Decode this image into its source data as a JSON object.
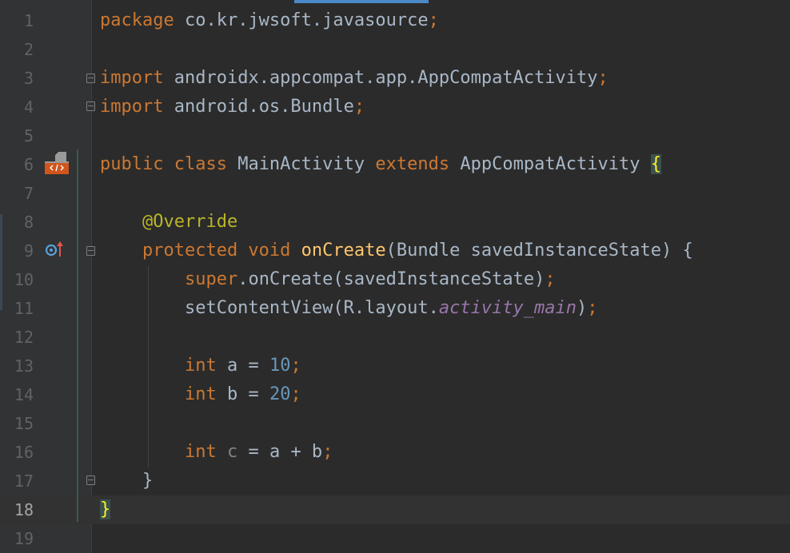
{
  "editor": {
    "lines": [
      {
        "n": "1",
        "code": [
          {
            "c": "kw",
            "t": "package"
          },
          {
            "t": " co.kr.jwsoft.javasource"
          },
          {
            "c": "kw",
            "t": ";"
          }
        ]
      },
      {
        "n": "2",
        "code": []
      },
      {
        "n": "3",
        "code": [
          {
            "c": "kw",
            "t": "import"
          },
          {
            "t": " androidx.appcompat.app.AppCompatActivity"
          },
          {
            "c": "kw",
            "t": ";"
          }
        ]
      },
      {
        "n": "4",
        "code": [
          {
            "c": "kw",
            "t": "import"
          },
          {
            "t": " android.os.Bundle"
          },
          {
            "c": "kw",
            "t": ";"
          }
        ]
      },
      {
        "n": "5",
        "code": []
      },
      {
        "n": "6",
        "code": [
          {
            "c": "kw",
            "t": "public class"
          },
          {
            "t": " MainActivity "
          },
          {
            "c": "kw",
            "t": "extends"
          },
          {
            "t": " AppCompatActivity "
          },
          {
            "c": "brace-hl",
            "t": "{"
          }
        ]
      },
      {
        "n": "7",
        "code": []
      },
      {
        "n": "8",
        "code": [
          {
            "t": "    "
          },
          {
            "c": "ann",
            "t": "@Override"
          }
        ]
      },
      {
        "n": "9",
        "code": [
          {
            "t": "    "
          },
          {
            "c": "kw",
            "t": "protected void"
          },
          {
            "t": " "
          },
          {
            "c": "fn",
            "t": "onCreate"
          },
          {
            "t": "(Bundle savedInstanceState) {"
          }
        ]
      },
      {
        "n": "10",
        "code": [
          {
            "t": "        "
          },
          {
            "c": "kw",
            "t": "super"
          },
          {
            "t": ".onCreate(savedInstanceState)"
          },
          {
            "c": "kw",
            "t": ";"
          }
        ]
      },
      {
        "n": "11",
        "code": [
          {
            "t": "        setContentView(R.layout."
          },
          {
            "c": "field",
            "t": "activity_main"
          },
          {
            "t": ")"
          },
          {
            "c": "kw",
            "t": ";"
          }
        ]
      },
      {
        "n": "12",
        "code": []
      },
      {
        "n": "13",
        "code": [
          {
            "t": "        "
          },
          {
            "c": "kw",
            "t": "int"
          },
          {
            "t": " a = "
          },
          {
            "c": "num",
            "t": "10"
          },
          {
            "c": "kw",
            "t": ";"
          }
        ]
      },
      {
        "n": "14",
        "code": [
          {
            "t": "        "
          },
          {
            "c": "kw",
            "t": "int"
          },
          {
            "t": " b = "
          },
          {
            "c": "num",
            "t": "20"
          },
          {
            "c": "kw",
            "t": ";"
          }
        ]
      },
      {
        "n": "15",
        "code": []
      },
      {
        "n": "16",
        "code": [
          {
            "t": "        "
          },
          {
            "c": "kw",
            "t": "int"
          },
          {
            "t": " "
          },
          {
            "c": "unused",
            "t": "c"
          },
          {
            "t": " = a + b"
          },
          {
            "c": "kw",
            "t": ";"
          }
        ]
      },
      {
        "n": "17",
        "code": [
          {
            "t": "    }"
          }
        ]
      },
      {
        "n": "18",
        "code": [
          {
            "c": "brace-hl",
            "t": "}"
          }
        ],
        "current": true
      },
      {
        "n": "19",
        "code": []
      }
    ],
    "gutter_icons": {
      "line6": "android-activity-icon",
      "line9": "overrides-method-icon"
    },
    "colors": {
      "background": "#2b2b2b",
      "keyword": "#cc7832",
      "annotation": "#bbb529",
      "method": "#ffc66d",
      "number": "#6897bb",
      "field": "#9876aa"
    }
  }
}
